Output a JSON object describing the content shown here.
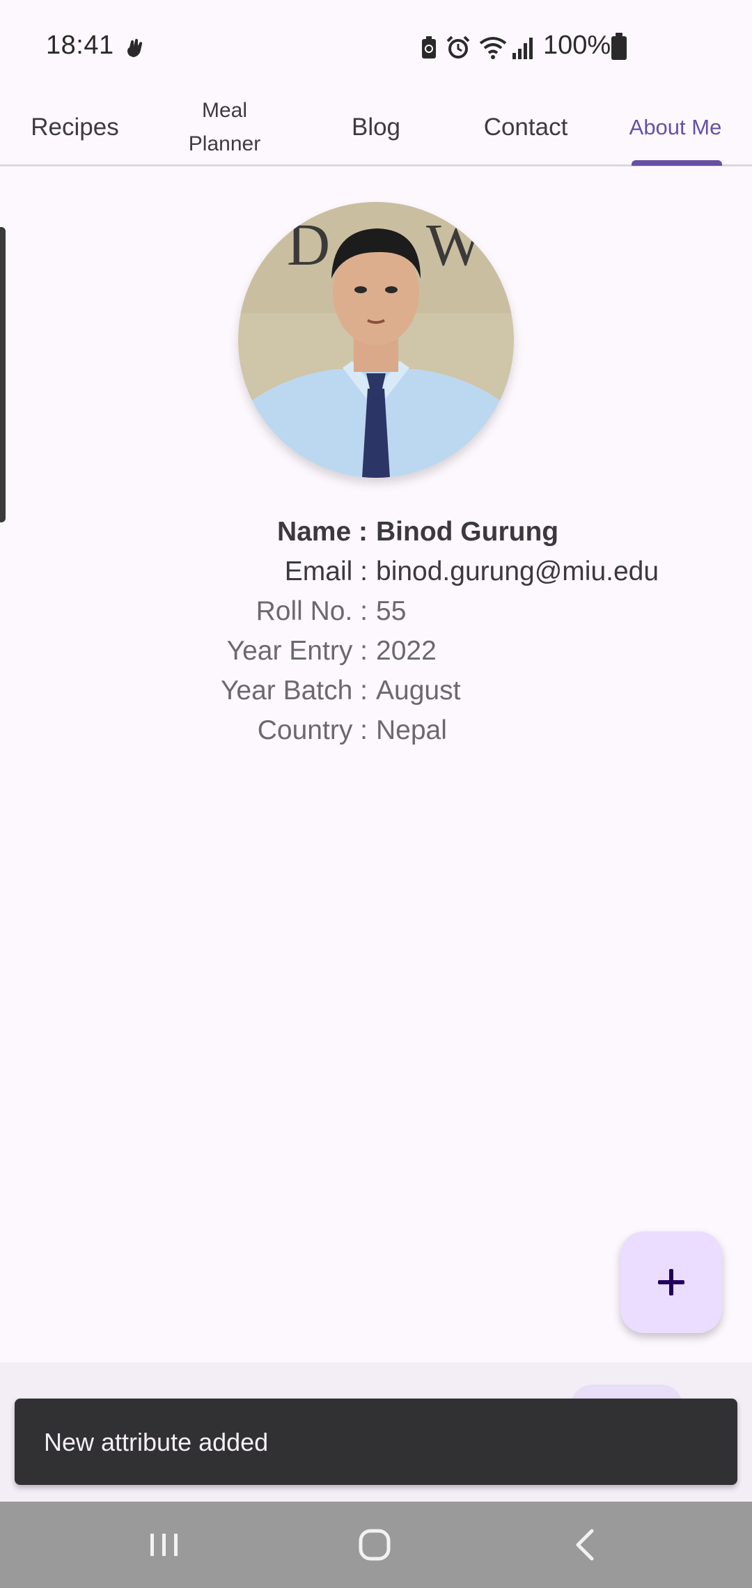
{
  "status_bar": {
    "time": "18:41",
    "battery_text": "100%",
    "icons": [
      "hand-icon",
      "battery-saver-icon",
      "alarm-icon",
      "wifi-icon",
      "signal-icon",
      "battery-icon"
    ]
  },
  "tabs": [
    {
      "label": "Recipes"
    },
    {
      "label_line1": "Meal",
      "label_line2": "Planner"
    },
    {
      "label": "Blog"
    },
    {
      "label": "Contact"
    },
    {
      "label": "About Me",
      "selected": true
    }
  ],
  "profile": {
    "avatar_icon": "profile-photo",
    "rows": [
      {
        "label": "Name :",
        "value": "Binod Gurung"
      },
      {
        "label": "Email :",
        "value": "binod.gurung@miu.edu"
      },
      {
        "label": "Roll No. :",
        "value": "55"
      },
      {
        "label": "Year Entry :",
        "value": "2022"
      },
      {
        "label": "Year Batch :",
        "value": "August"
      },
      {
        "label": "Country :",
        "value": "Nepal"
      }
    ]
  },
  "fab": {
    "icon": "plus-icon"
  },
  "snackbar": {
    "message": "New attribute added"
  },
  "nav_bar": {
    "icons": [
      "recent-apps-icon",
      "home-icon",
      "back-icon"
    ]
  },
  "colors": {
    "accent": "#6750a4",
    "fab_bg": "#eaddff",
    "snackbar_bg": "#313033",
    "page_bg": "#fdf8fd"
  }
}
